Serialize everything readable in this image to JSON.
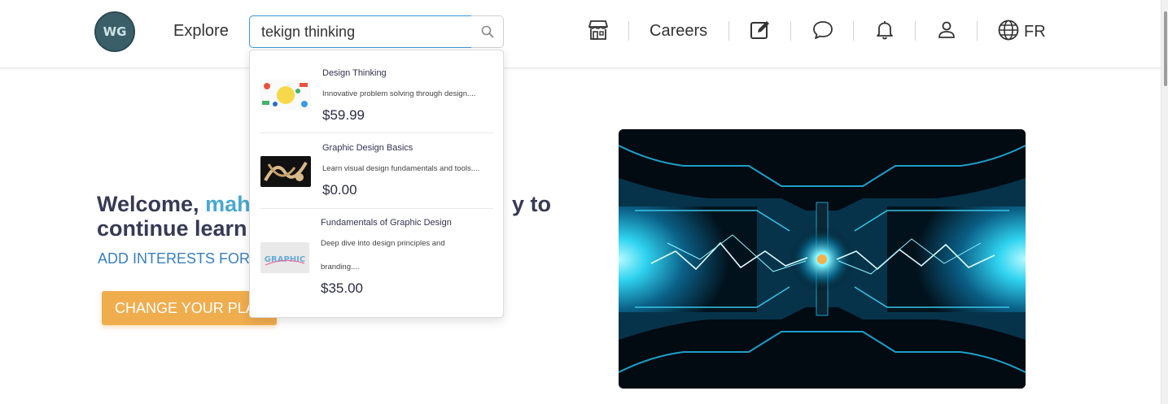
{
  "header": {
    "logo_text": "WG",
    "explore_label": "Explore",
    "search": {
      "value": "tekign thinking",
      "placeholder": ""
    },
    "careers_label": "Careers",
    "language_label": "FR"
  },
  "hero": {
    "welcome_prefix": "Welcome, ",
    "welcome_name": "mah",
    "welcome_line1_end": "y to",
    "welcome_line2": "continue learn",
    "interests_label": "ADD INTERESTS FOR",
    "change_plan_label": "CHANGE YOUR PLA"
  },
  "search_results": [
    {
      "title": "Design Thinking",
      "description": "Innovative problem solving through design....",
      "price": "$59.99"
    },
    {
      "title": "Graphic Design Basics",
      "description": "Learn visual design fundamentals and tools....",
      "price": "$0.00"
    },
    {
      "title": "Fundamentals of Graphic Design",
      "description_line1": "Deep dive into design principles and",
      "description_line2": "branding....",
      "price": "$35.00"
    }
  ],
  "colors": {
    "accent_blue": "#3a97d8",
    "name_blue": "#4aa8cf",
    "button_orange": "#f0ad4e",
    "heading": "#373a55"
  },
  "icons": [
    "store-icon",
    "edit-icon",
    "chat-icon",
    "bell-icon",
    "user-icon",
    "globe-icon",
    "search-icon"
  ]
}
